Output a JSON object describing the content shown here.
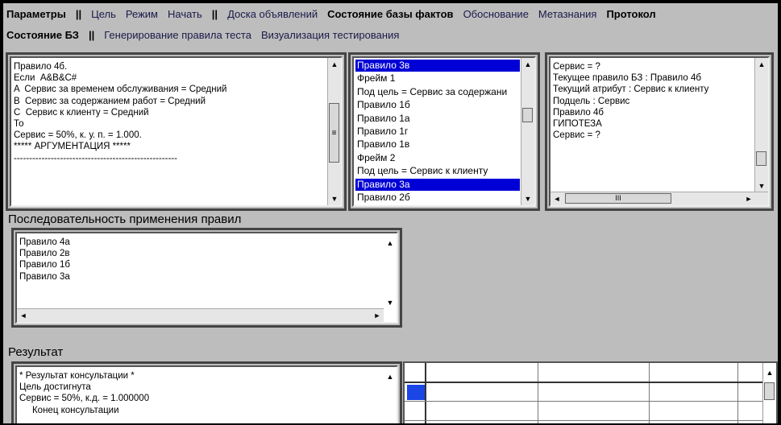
{
  "menu_row1": [
    {
      "label": "Параметры",
      "bold": true
    },
    {
      "sep": "||"
    },
    {
      "label": "Цель"
    },
    {
      "label": "Режим"
    },
    {
      "label": "Начать"
    },
    {
      "sep": "||"
    },
    {
      "label": "Доска объявлений"
    },
    {
      "label": "Состояние базы фактов",
      "bold": true
    },
    {
      "label": "Обоснование"
    },
    {
      "label": "Метазнания"
    },
    {
      "label": "Протокол",
      "bold": true
    }
  ],
  "menu_row2": [
    {
      "label": "Состояние БЗ",
      "bold": true
    },
    {
      "sep": "||"
    },
    {
      "label": "Генерирование правила теста"
    },
    {
      "label": "Визуализация тестирования"
    }
  ],
  "rule_panel": {
    "text": "Правило 4б.\nЕсли  A&B&C#\nA  Сервис за временем обслуживания = Средний\nB  Сервис за содержанием работ = Средний\nC  Сервис к клиенту = Средний\nТо\nСервис = 50%, к. у. п. = 1.000.\n***** АРГУМЕНТАЦИЯ *****\n-----------------------------------------------------"
  },
  "frame_list": {
    "items": [
      "Правило 3в",
      "Фрейм 1",
      "Под цель = Сервис за содержани",
      "Правило 1б",
      "Правило 1а",
      "Правило 1г",
      "Правило 1в",
      "Фрейм 2",
      "Под цель = Сервис к клиенту",
      "Правило 3а",
      "Правило 2б"
    ],
    "focused_index": 0,
    "selected_index": 9
  },
  "status_panel": {
    "text": "Сервис = ?\nТекущее правило БЗ : Правило 4б\nТекущий атрибут : Сервис к клиенту\nПодцель : Сервис\nПравило 4б\nГИПОТЕЗА\nСервис = ?",
    "hscroll_thumb": "III"
  },
  "sequence": {
    "title": "Последовательность применения правил",
    "text": "Правило 4а\nПравило 2в\nПравило 1б\nПравило 3а"
  },
  "result": {
    "title": "Результат",
    "text": "* Результат консультации *\nЦель достигнута\nСервис = 50%, к.д. = 1.000000\n     Конец консультации"
  },
  "scroll": {
    "up": "▲",
    "down": "▼",
    "left": "◄",
    "right": "►"
  },
  "colors": {
    "background": "#bdbdbd",
    "selection": "#0000d6",
    "grid_selection": "#1a46e6"
  }
}
